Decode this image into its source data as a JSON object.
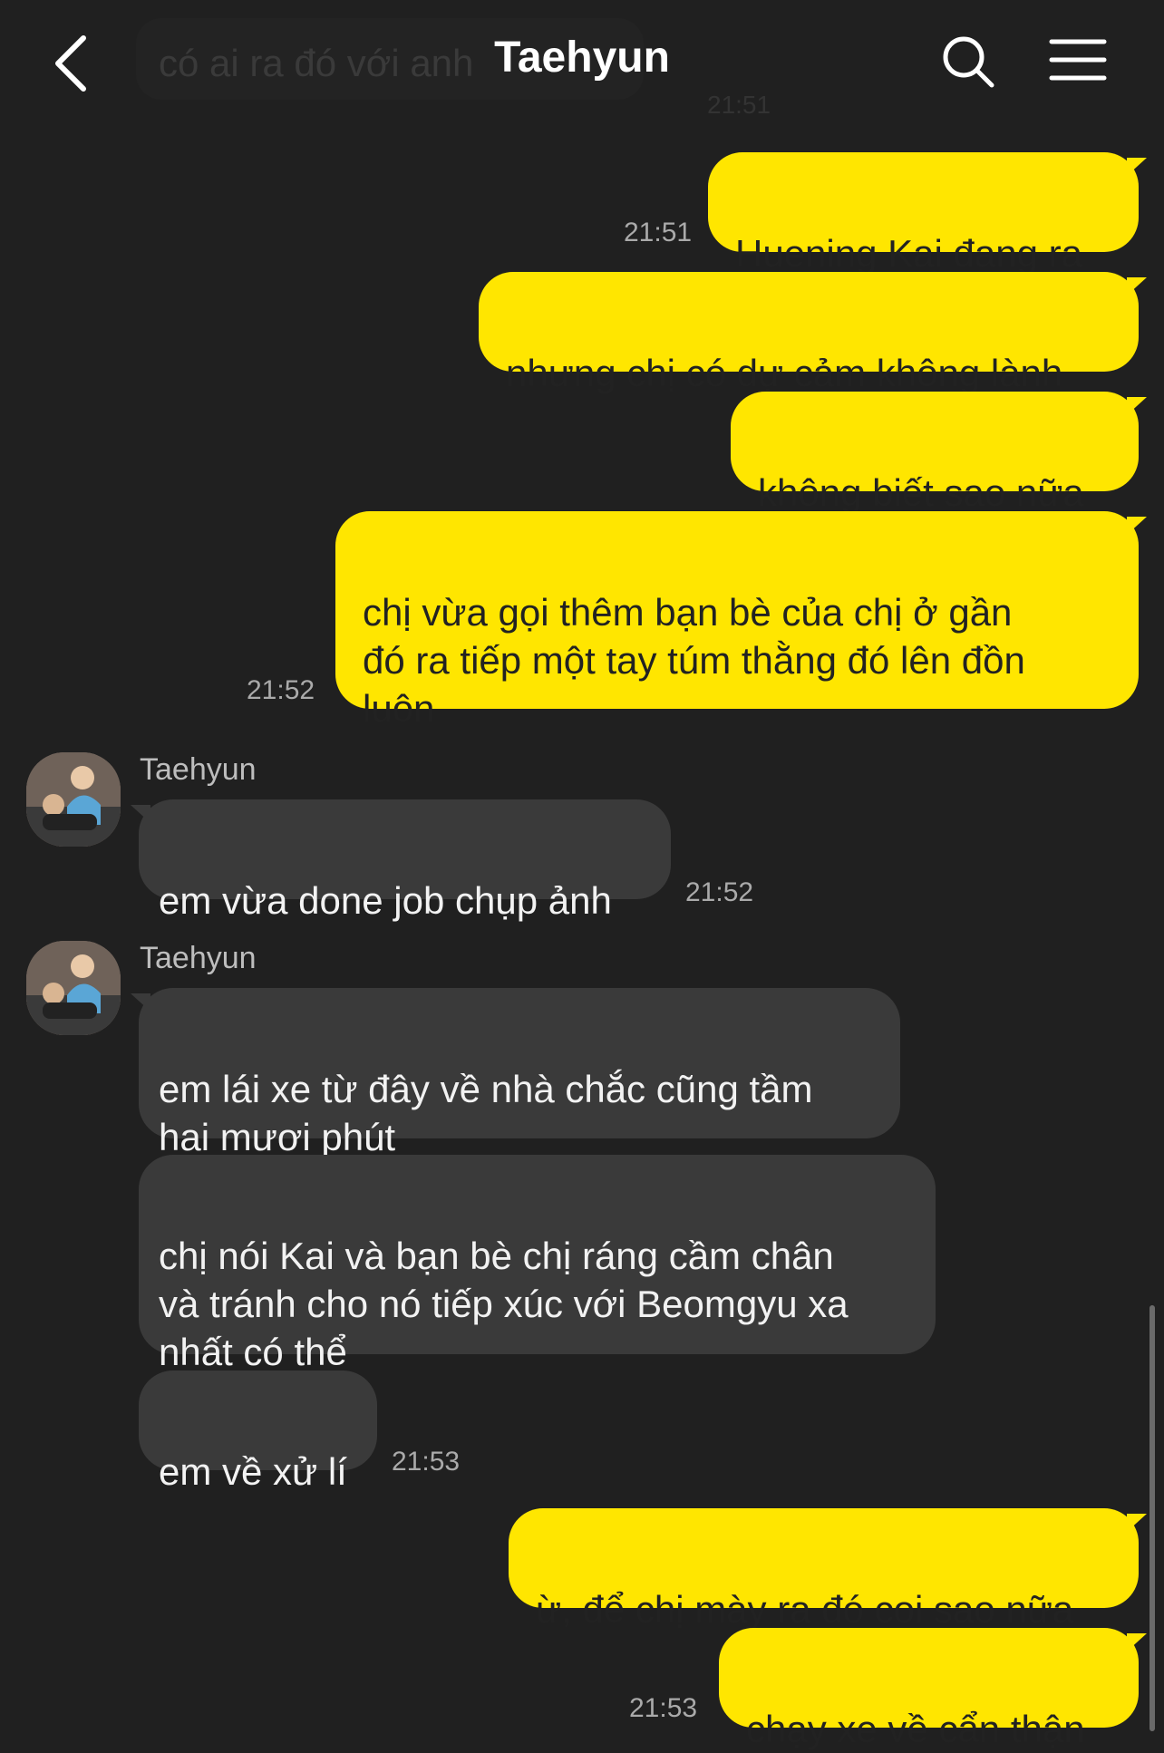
{
  "header": {
    "title": "Taehyun",
    "prev_message_preview": "có ai ra đó với anh",
    "prev_message_time": "21:51"
  },
  "messages": {
    "m1": {
      "text": "Huening Kai đang ra",
      "time": "21:51"
    },
    "m2": {
      "text": "nhưng chị có dự cảm không lành"
    },
    "m3": {
      "text": "không biết sao nữa"
    },
    "m4": {
      "text": "chị vừa gọi thêm bạn bè của chị ở gần\nđó ra tiếp một tay túm thằng đó lên đồn\nluôn",
      "time": "21:52"
    },
    "m5": {
      "sender": "Taehyun",
      "text": "em vừa done job chụp ảnh",
      "time": "21:52"
    },
    "m6": {
      "sender": "Taehyun",
      "text": "em lái xe từ đây về nhà chắc cũng tầm\nhai mươi phút"
    },
    "m7": {
      "text": "chị nói Kai và bạn bè chị ráng cầm chân\nvà tránh cho nó tiếp xúc với Beomgyu xa\nnhất có thể"
    },
    "m8": {
      "text": "em về xử lí",
      "time": "21:53"
    },
    "m9": {
      "text": "ừ, để chị mày ra đó coi sao nữa"
    },
    "m10": {
      "text": "chạy xe về cẩn thận",
      "time": "21:53"
    }
  },
  "icons": {
    "back": "chevron-left-icon",
    "search": "search-icon",
    "menu": "hamburger-menu-icon",
    "avatar": "avatar"
  },
  "colors": {
    "background": "#202020",
    "outgoing_bubble": "#FFE600",
    "incoming_bubble": "#3a3a3a",
    "outgoing_text": "#222222",
    "timestamp": "#aaaaaa"
  }
}
